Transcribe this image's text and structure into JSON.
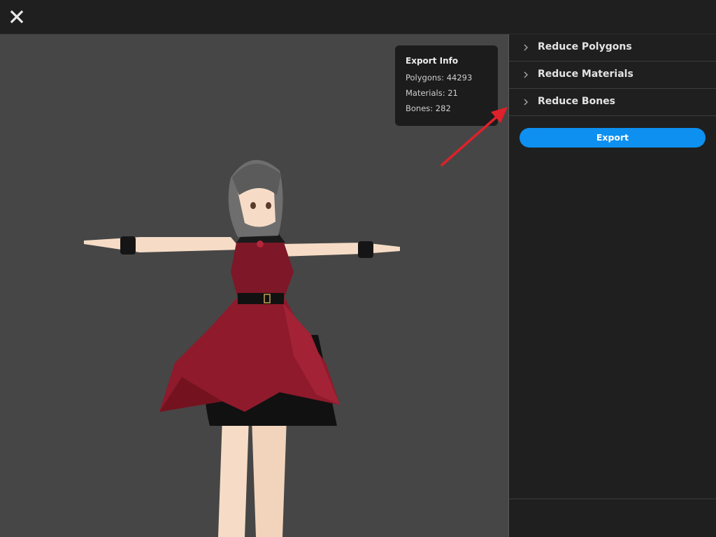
{
  "window": {
    "title": "",
    "close_icon": "close-icon"
  },
  "export_info": {
    "title": "Export Info",
    "polygons": "Polygons: 44293",
    "materials": "Materials: 21",
    "bones": "Bones: 282"
  },
  "panel": {
    "sections": [
      {
        "label": "Reduce Polygons",
        "icon": "chevron-right-icon"
      },
      {
        "label": "Reduce Materials",
        "icon": "chevron-right-icon"
      },
      {
        "label": "Reduce Bones",
        "icon": "chevron-right-icon"
      }
    ],
    "export_label": "Export"
  },
  "colors": {
    "accent": "#0d90f0",
    "viewport_bg": "#464646",
    "panel_bg": "#1f1f1f",
    "annotation_arrow": "#e0202a",
    "dress_red": "#8e1a2c"
  }
}
